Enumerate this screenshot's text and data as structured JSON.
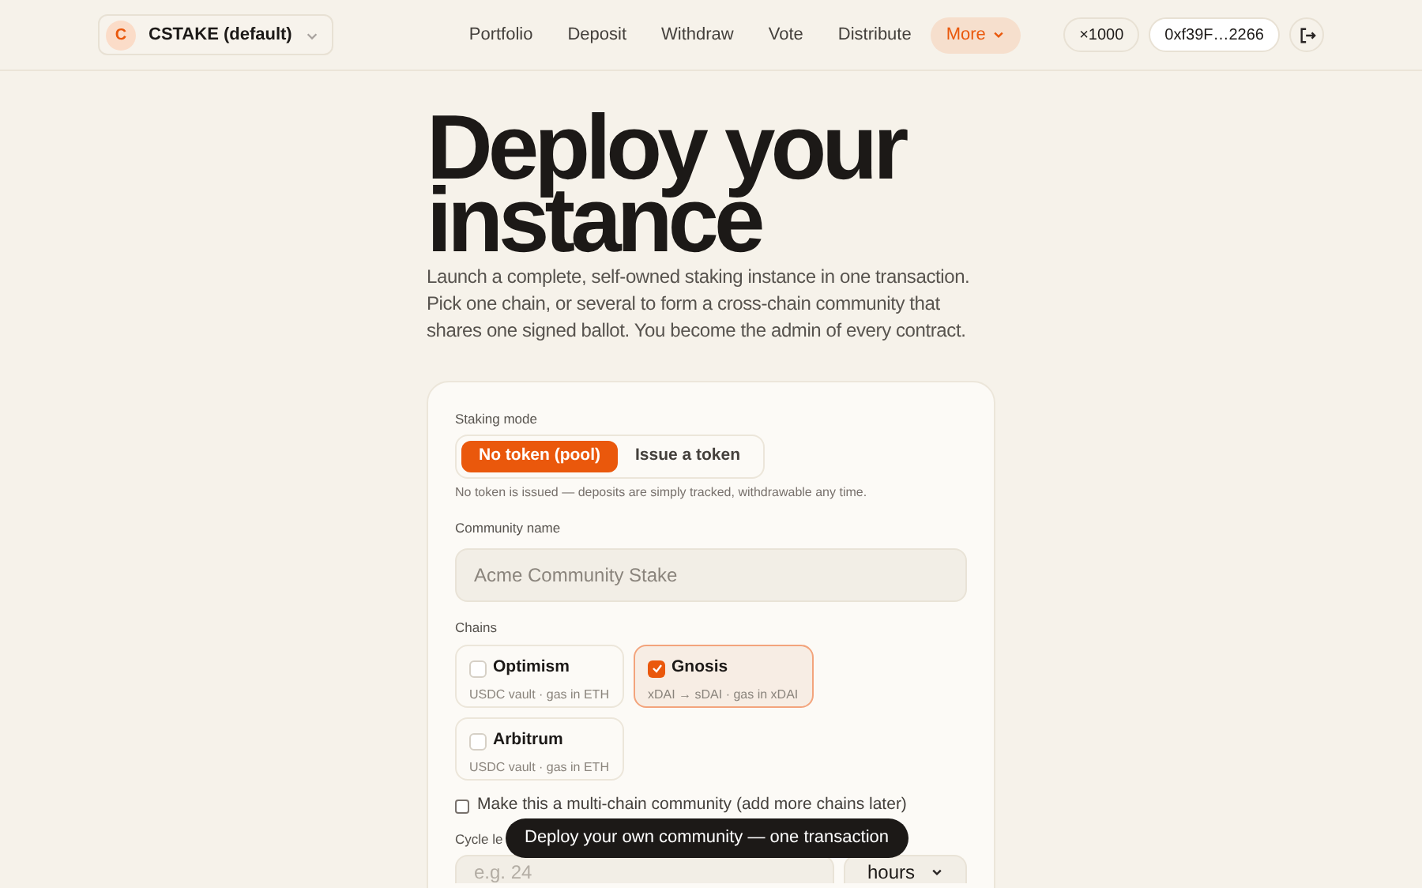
{
  "community_selector": {
    "badge": "C",
    "label": "CSTAKE (default)"
  },
  "nav": [
    {
      "label": "Portfolio",
      "selected": false
    },
    {
      "label": "Deposit",
      "selected": false
    },
    {
      "label": "Withdraw",
      "selected": false
    },
    {
      "label": "Vote",
      "selected": false
    },
    {
      "label": "Distribute",
      "selected": false
    },
    {
      "label": "More",
      "selected": true
    }
  ],
  "multiplier": "×1000",
  "wallet": "0xf39F…2266",
  "heading": "Deploy your instance",
  "intro": "Launch a complete, self-owned staking instance in one transaction. Pick one chain, or several to form a cross-chain community that shares one signed ballot. You become the admin of every contract.",
  "form": {
    "staking_mode": {
      "label": "Staking mode",
      "options": [
        {
          "label": "No token (pool)",
          "selected": true
        },
        {
          "label": "Issue a token",
          "selected": false
        }
      ],
      "hint": "No token is issued — deposits are simply tracked, withdrawable any time."
    },
    "community_name": {
      "label": "Community name",
      "placeholder": "Acme Community Stake"
    },
    "chains": {
      "label": "Chains",
      "items": [
        {
          "name": "Optimism",
          "detail": "USDC vault · gas in ETH",
          "checked": false
        },
        {
          "name": "Gnosis",
          "detail": "xDAI → sDAI · gas in xDAI",
          "checked": true
        },
        {
          "name": "Arbitrum",
          "detail": "USDC vault · gas in ETH",
          "checked": false
        }
      ]
    },
    "multi_chain": {
      "label": "Make this a multi-chain community (add more chains later)",
      "checked": false
    },
    "cycle_length": {
      "label": "Cycle le",
      "placeholder": "e.g. 24",
      "unit": "hours"
    }
  },
  "tooltip": "Deploy your own community — one transaction"
}
